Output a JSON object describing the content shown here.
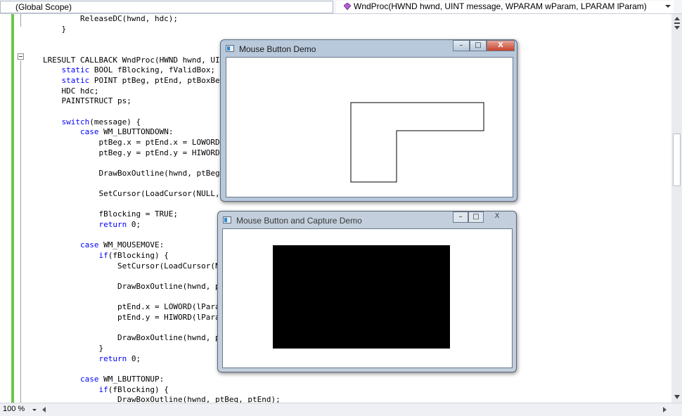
{
  "navbar": {
    "scope": "(Global Scope)",
    "function": "WndProc(HWND hwnd, UINT message, WPARAM wParam, LPARAM lParam)"
  },
  "editor": {
    "lines": [
      "        ReleaseDC(hwnd, hdc);",
      "    }",
      "",
      "",
      "LRESULT CALLBACK WndProc(HWND hwnd, UINT",
      "    static BOOL fBlocking, fValidBox;",
      "    static POINT ptBeg, ptEnd, ptBoxBeg",
      "    HDC hdc;",
      "    PAINTSTRUCT ps;",
      "",
      "    switch(message) {",
      "        case WM_LBUTTONDOWN:",
      "            ptBeg.x = ptEnd.x = LOWORD(",
      "            ptBeg.y = ptEnd.y = HIWORD(",
      "",
      "            DrawBoxOutline(hwnd, ptBeg,",
      "",
      "            SetCursor(LoadCursor(NULL, I",
      "",
      "            fBlocking = TRUE;",
      "            return 0;",
      "",
      "        case WM_MOUSEMOVE:",
      "            if(fBlocking) {",
      "                SetCursor(LoadCursor(NU",
      "",
      "                DrawBoxOutline(hwnd, pt",
      "",
      "                ptEnd.x = LOWORD(lParam",
      "                ptEnd.y = HIWORD(lParam",
      "",
      "                DrawBoxOutline(hwnd, pt",
      "            }",
      "            return 0;",
      "",
      "        case WM_LBUTTONUP:",
      "            if(fBlocking) {",
      "                DrawBoxOutline(hwnd, ptBeg, ptEnd);"
    ]
  },
  "status": {
    "zoom": "100 %"
  },
  "windows": {
    "mouse_button_demo": {
      "title": "Mouse Button Demo"
    },
    "capture_demo": {
      "title": "Mouse Button and Capture Demo"
    }
  },
  "icons": {
    "minimize": "–",
    "maximize": "□",
    "close": "X"
  },
  "colors": {
    "keyword": "#0000ff",
    "change_bar": "#67c94a",
    "filled_box": "#000000"
  }
}
